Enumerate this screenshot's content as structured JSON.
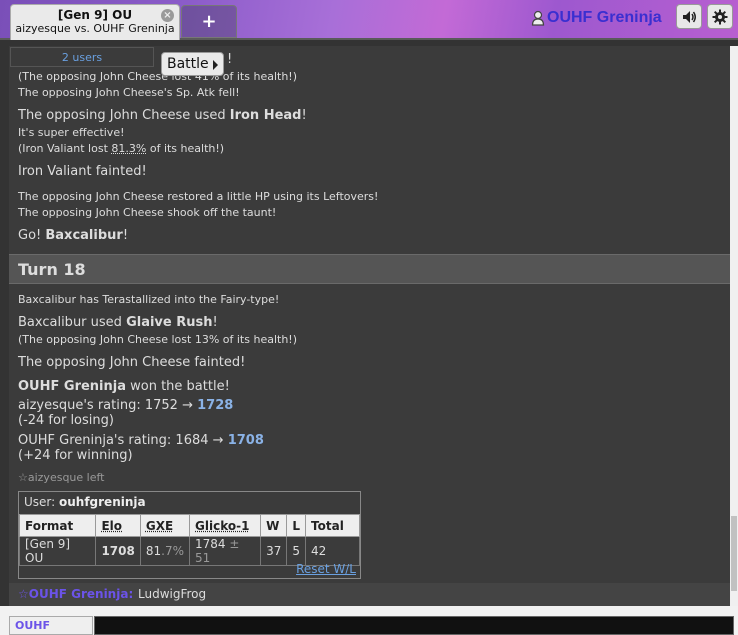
{
  "tab": {
    "title": "[Gen 9] OU",
    "subtitle": "aizyesque vs. OUHF Greninja",
    "close_icon": "×"
  },
  "new_tab_label": "+",
  "user": {
    "name": "OUHF Greninja"
  },
  "icons": {
    "user": "user-icon",
    "sound": "volume-icon",
    "settings": "gear-icon"
  },
  "users_label": "2 users",
  "battle_button": "Battle",
  "log": {
    "partial_top_line": "!",
    "line1": "(The opposing John Cheese lost 41% of its health!)",
    "line2": "The opposing John Cheese's Sp. Atk fell!",
    "move1": {
      "prefix": "The opposing John Cheese used ",
      "move": "Iron Head",
      "suffix": "!"
    },
    "super_effective": "It's super effective!",
    "iv_lost": {
      "prefix": "(Iron Valiant lost ",
      "percent": "81.3%",
      "suffix": " of its health!)"
    },
    "fainted1": "Iron Valiant fainted!",
    "leftovers": "The opposing John Cheese restored a little HP using its Leftovers!",
    "taunt": "The opposing John Cheese shook off the taunt!",
    "go": {
      "prefix": "Go! ",
      "name": "Baxcalibur",
      "suffix": "!"
    },
    "turn": "Turn 18",
    "tera": "Baxcalibur has Terastallized into the Fairy-type!",
    "move2": {
      "prefix": "Baxcalibur used ",
      "move": "Glaive Rush",
      "suffix": "!"
    },
    "lost13": "(The opposing John Cheese lost 13% of its health!)",
    "fainted2": "The opposing John Cheese fainted!",
    "won": {
      "name": "OUHF Greninja",
      "suffix": " won the battle!"
    },
    "rating1": {
      "prefix": "aizyesque's rating: 1752 → ",
      "value": "1728"
    },
    "rating1_change": "(-24 for losing)",
    "rating2": {
      "prefix": "OUHF Greninja's rating: 1684 → ",
      "value": "1708"
    },
    "rating2_change": "(+24 for winning)",
    "left": "☆aizyesque left"
  },
  "stats": {
    "user_label": "User: ",
    "username": "ouhfgreninja",
    "headers": [
      "Format",
      "Elo",
      "GXE",
      "Glicko-1",
      "W",
      "L",
      "Total"
    ],
    "row": {
      "format": "[Gen 9] OU",
      "elo": "1708",
      "gxe": "81",
      "gxe_dec": ".7%",
      "glicko": "1784",
      "glicko_dev": " ± 51",
      "w": "37",
      "l": "5",
      "total": "42"
    },
    "reset": "Reset W/L"
  },
  "chat": {
    "who": "☆OUHF Greninja:",
    "message": "LudwigFrog"
  },
  "bottom": {
    "name": "OUHF Greninja"
  },
  "colors": {
    "accent": "#6b53e8",
    "link": "#6aa0e0",
    "rating": "#8ab2e6"
  }
}
